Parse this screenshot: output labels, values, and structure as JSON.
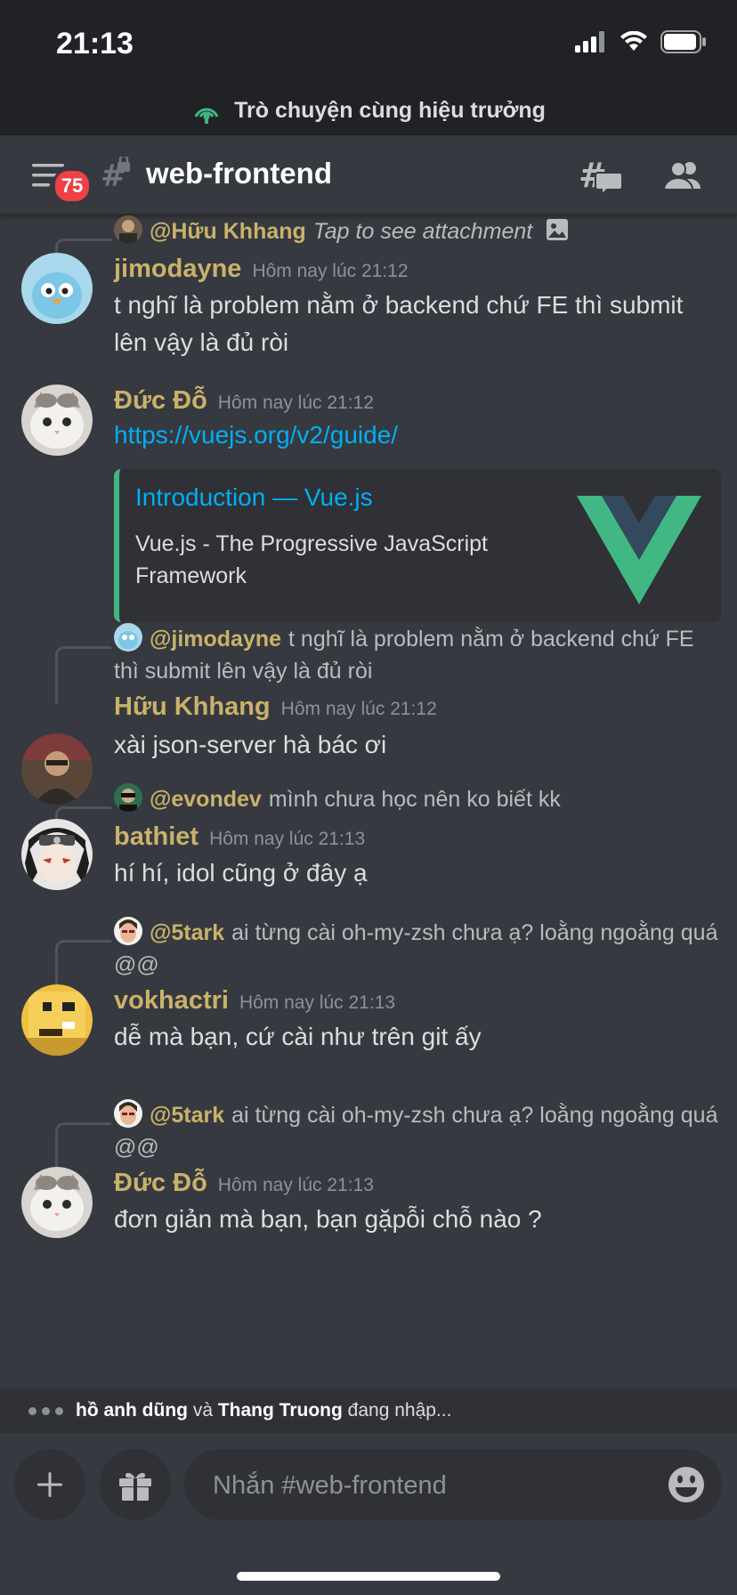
{
  "status": {
    "time": "21:13"
  },
  "voice": {
    "label": "Trò chuyện cùng hiệu trưởng"
  },
  "header": {
    "unread_badge": "75",
    "channel_name": "web-frontend"
  },
  "messages": [
    {
      "reply_user": "@Hữu Khhang",
      "reply_text": "Tap to see attachment",
      "user": "jimodayne",
      "timestamp": "Hôm nay lúc 21:12",
      "text": "t nghĩ là problem nằm ở backend chứ FE thì submit lên vậy là đủ ròi"
    },
    {
      "user": "Đức Đỗ",
      "timestamp": "Hôm nay lúc 21:12",
      "link": "https://vuejs.org/v2/guide/",
      "embed": {
        "title": "Introduction — Vue.js",
        "description": "Vue.js - The Progressive JavaScript Framework",
        "accent_color": "#43b581"
      }
    },
    {
      "reply_user": "@jimodayne",
      "reply_text": "t nghĩ là problem nằm ở backend chứ FE thì submit lên vậy là đủ ròi",
      "user": "Hữu Khhang",
      "timestamp": "Hôm nay lúc 21:12",
      "text": "xài json-server hà bác ơi"
    },
    {
      "reply_user": "@evondev",
      "reply_text": "mình chưa học nên ko biết kk",
      "user": "bathiet",
      "timestamp": "Hôm nay lúc 21:13",
      "text": "hí hí, idol cũng ở đây ạ"
    },
    {
      "reply_user": "@5tark",
      "reply_text": "ai từng cài oh-my-zsh chưa ạ? loằng ngoằng quá @@",
      "user": "vokhactri",
      "timestamp": "Hôm nay lúc 21:13",
      "text": "dễ mà bạn, cứ cài như trên git ấy"
    },
    {
      "reply_user": "@5tark",
      "reply_text": "ai từng cài oh-my-zsh chưa ạ? loằng ngoằng quá @@",
      "user": "Đức Đỗ",
      "timestamp": "Hôm nay lúc 21:13",
      "text": "đơn giản mà bạn, bạn gặpỗi chỗ nào ?"
    }
  ],
  "typing": {
    "user1": "hồ anh dũng",
    "conj": " và ",
    "user2": "Thang Truong",
    "suffix": " đang nhập..."
  },
  "composer": {
    "placeholder": "Nhắn #web-frontend"
  },
  "colors": {
    "username": "#c9b26a",
    "link": "#00aff4",
    "background": "#36393f",
    "badge": "#ed4245"
  }
}
